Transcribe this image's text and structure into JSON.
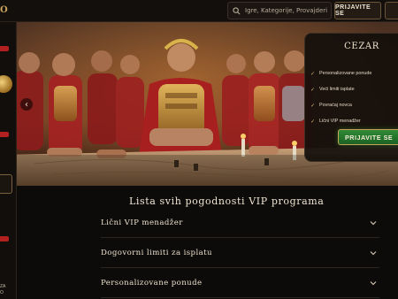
{
  "header": {
    "logo_fragment": "O",
    "search_placeholder": "Igre, Kategorije, Provajderi",
    "login_label": "PRIJAVITE SE"
  },
  "sidebar": {
    "bottom_text_line1": "ZA",
    "bottom_text_line2": "O"
  },
  "hero": {
    "card": {
      "title": "CEZAR",
      "benefits": [
        "Personalizovane ponude",
        "Veći limiti isplate",
        "Povraćaj novca",
        "Lični VIP menadžer"
      ],
      "cta_label": "PRIJAVITE SE"
    }
  },
  "main": {
    "title": "Lista svih pogodnosti VIP programa",
    "accordion": [
      {
        "label": "Lični VIP menadžer"
      },
      {
        "label": "Dogovorni limiti za isplatu"
      },
      {
        "label": "Personalizovane ponude"
      }
    ]
  },
  "colors": {
    "background": "#0d0b09",
    "accent_gold": "#c9a25a",
    "cta_green": "#2f8a35",
    "sidebar_red": "#b32020"
  }
}
